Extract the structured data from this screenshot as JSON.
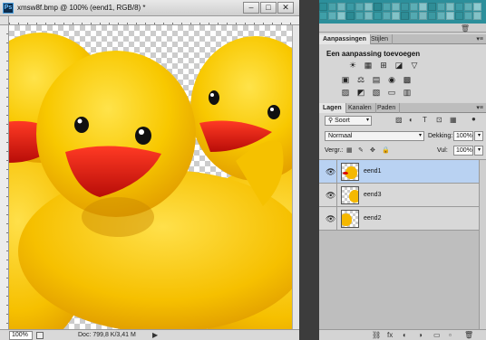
{
  "document": {
    "title": "xmsw8f.bmp @ 100% (eend1, RGB/8) *",
    "window_buttons": {
      "minimize": "–",
      "maximize": "□",
      "close": "✕"
    },
    "zoom": "100%",
    "doc_info": "Doc: 799,8 K/3,41 M",
    "status_arrow": "▶"
  },
  "swatches": {
    "colors": [
      "#2d8f98",
      "#4aa3ab",
      "#6fb6bd",
      "#3a9aa5",
      "#58aab2",
      "#80c1c6",
      "#2a8891",
      "#4ea6ae",
      "#72b9bf",
      "#3a97a1",
      "#5daeb5",
      "#88c5ca",
      "#2f8d96",
      "#50a7af",
      "#7cbec3",
      "#3c9ca6",
      "#60b0b7",
      "#8ecbd0",
      "#3e9fa8",
      "#5eb0b8",
      "#87c6cb",
      "#2b8a93",
      "#4fa8b0",
      "#76bbc1",
      "#379aa3",
      "#5aadb5",
      "#82c3c8",
      "#2e8c95",
      "#53a9b1",
      "#7ab9bf",
      "#3b99a2",
      "#62b2b9",
      "#8fcad0",
      "#33939c",
      "#57abb3",
      "#83c2c7"
    ],
    "trash_icon": "trash-icon"
  },
  "adjust_panel": {
    "tabs": [
      {
        "label": "Aanpassingen",
        "active": true
      },
      {
        "label": "Stijlen",
        "active": false
      }
    ],
    "menu_glyph": "▾≡",
    "title": "Een aanpassing toevoegen",
    "row1": [
      "☀",
      "▦",
      "⊞",
      "◪",
      "▽"
    ],
    "row2": [
      "▣",
      "⚖",
      "▤",
      "◉",
      "▩"
    ],
    "row3": [
      "▨",
      "◩",
      "▧",
      "▭",
      "▥"
    ]
  },
  "layers_panel": {
    "tabs": [
      {
        "label": "Lagen",
        "active": true
      },
      {
        "label": "Kanalen",
        "active": false
      },
      {
        "label": "Paden",
        "active": false
      }
    ],
    "menu_glyph": "▾≡",
    "filter": "Soort",
    "filter_icons": [
      "▨",
      "◐",
      "T",
      "⊡",
      "▦"
    ],
    "blend_mode": "Normaal",
    "opacity_label": "Dekking:",
    "opacity_value": "100%",
    "lock_label": "Vergr.:",
    "lock_icons": [
      "▦",
      "✎",
      "✥",
      "🔒"
    ],
    "fill_label": "Vul:",
    "fill_value": "100%",
    "layers": [
      {
        "name": "eend1",
        "selected": true
      },
      {
        "name": "eend3",
        "selected": false
      },
      {
        "name": "eend2",
        "selected": false
      }
    ],
    "bottom_icons": [
      "⛓",
      "fx",
      "◐",
      "◑",
      "▭",
      "▫",
      "🗑"
    ]
  },
  "colors": {
    "duck_yellow": "#f7c600",
    "beak_red": "#d41a10",
    "selection_blue": "#b9d2f2"
  }
}
